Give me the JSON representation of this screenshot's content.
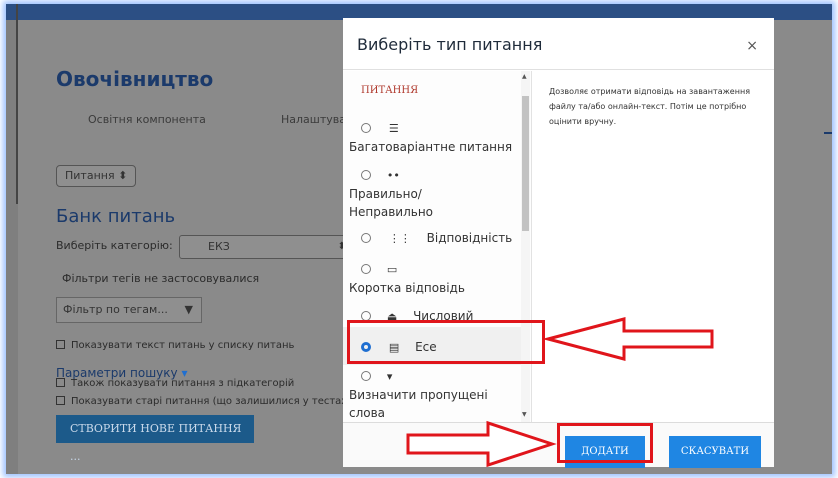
{
  "page": {
    "title": "Овочівництво",
    "tabs": [
      "Освітня компонента",
      "Налаштува"
    ],
    "questions_select": "Питання",
    "bank_title": "Банк питань",
    "category_label": "Виберіть категорію:",
    "category_value": "ЕКЗ",
    "tags_note": "Фільтри тегів не застосовувалися",
    "tag_filter_placeholder": "Фільтр по тегам...",
    "show_text_option": "Показувати текст питань у списку питань",
    "search_params": "Параметри пошуку",
    "subcategories_option": "Також показувати питання з підкатегорій",
    "old_questions_option": "Показувати старі питання (що залишилися у тестах пі",
    "create_button": "СТВОРИТИ НОВЕ ПИТАННЯ ..."
  },
  "modal": {
    "title": "Виберіть тип питання",
    "close": "×",
    "section_heading": "ПИТАННЯ",
    "question_types": [
      {
        "label": "Багатоваріантне питання",
        "icon": "list-icon",
        "selected": false
      },
      {
        "label": "Правильно/ Неправильно",
        "icon": "dots-icon",
        "selected": false
      },
      {
        "label": "Відповідність",
        "icon": "grid-icon",
        "selected": false
      },
      {
        "label": "Коротка відповідь",
        "icon": "short-answer-icon",
        "selected": false
      },
      {
        "label": "Числовий",
        "icon": "numerical-icon",
        "selected": false
      },
      {
        "label": "Есе",
        "icon": "essay-icon",
        "selected": true
      },
      {
        "label": "Визначити пропущені слова",
        "icon": "dropdown-icon",
        "selected": false
      }
    ],
    "description": "Дозволяє отримати відповідь на завантаження файлу та/або онлайн-текст. Потім це потрібно оцінити вручну.",
    "add_button": "ДОДАТИ",
    "cancel_button": "СКАСУВАТИ"
  },
  "colors": {
    "accent": "#1f86e3",
    "highlight": "#e0151b",
    "header_bar": "#2c4f84",
    "title_text": "#1b3a6b"
  }
}
